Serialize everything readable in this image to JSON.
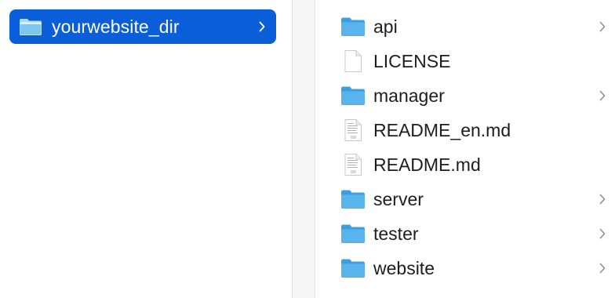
{
  "left_column": {
    "selected_folder": {
      "label": "yourwebsite_dir",
      "icon": "folder-icon",
      "has_children": true
    }
  },
  "right_column": {
    "items": [
      {
        "label": "api",
        "kind": "folder",
        "icon": "folder-icon",
        "has_children": true
      },
      {
        "label": "LICENSE",
        "kind": "file",
        "icon": "file-icon",
        "has_children": false
      },
      {
        "label": "manager",
        "kind": "folder",
        "icon": "folder-icon",
        "has_children": true
      },
      {
        "label": "README_en.md",
        "kind": "markdown",
        "icon": "markdown-file-icon",
        "has_children": false
      },
      {
        "label": "README.md",
        "kind": "markdown",
        "icon": "markdown-file-icon",
        "has_children": false
      },
      {
        "label": "server",
        "kind": "folder",
        "icon": "folder-icon",
        "has_children": true
      },
      {
        "label": "tester",
        "kind": "folder",
        "icon": "folder-icon",
        "has_children": true
      },
      {
        "label": "website",
        "kind": "folder",
        "icon": "folder-icon",
        "has_children": true
      }
    ]
  },
  "colors": {
    "selection": "#0a5fd8",
    "folder": "#5ab4ec",
    "text": "#1d1d1f",
    "chevron": "#8e8e93"
  }
}
